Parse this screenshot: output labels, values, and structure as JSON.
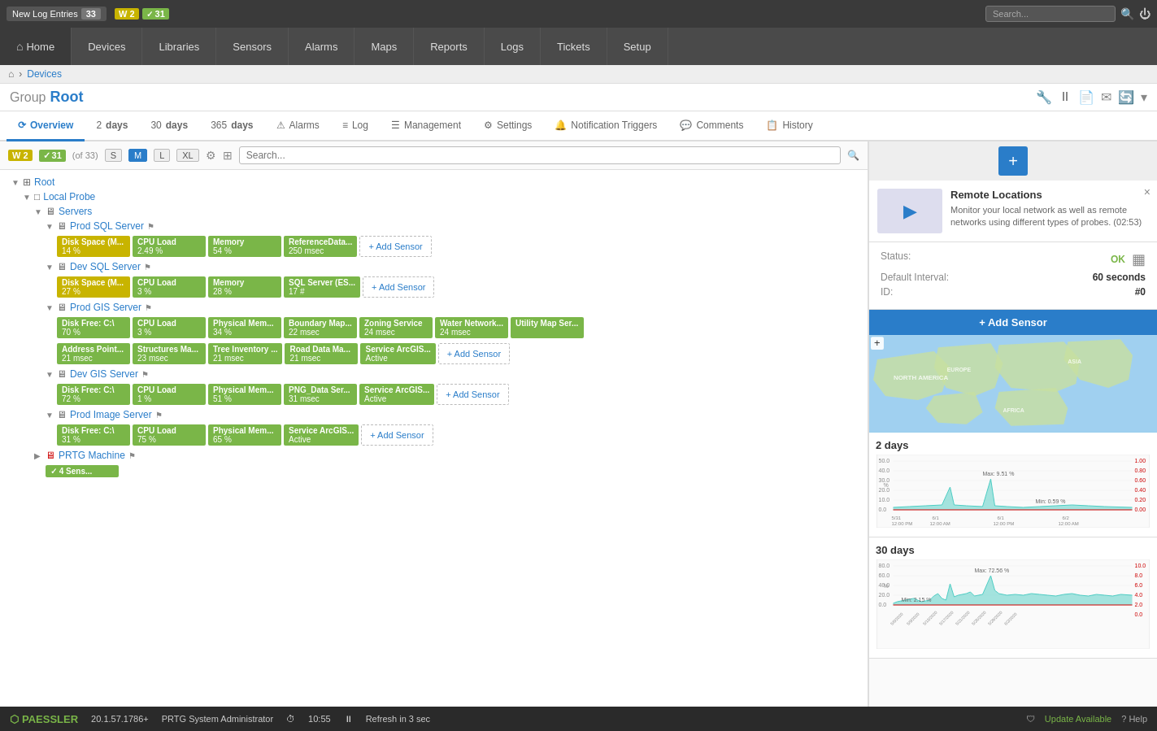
{
  "topbar": {
    "log_entries_label": "New Log Entries",
    "log_entries_count": "33",
    "warnings_label": "W",
    "warnings_count": "2",
    "ok_label": "31",
    "search_placeholder": "Search...",
    "search_label": "Search"
  },
  "mainnav": {
    "home": "Home",
    "devices": "Devices",
    "libraries": "Libraries",
    "sensors": "Sensors",
    "alarms": "Alarms",
    "maps": "Maps",
    "reports": "Reports",
    "logs": "Logs",
    "tickets": "Tickets",
    "setup": "Setup"
  },
  "breadcrumb": {
    "home": "⌂",
    "devices": "Devices"
  },
  "group": {
    "label": "Group",
    "title": "Root"
  },
  "tabs": [
    {
      "id": "overview",
      "label": "Overview",
      "icon": "⟳",
      "active": true
    },
    {
      "id": "2days",
      "label": "2  days",
      "icon": ""
    },
    {
      "id": "30days",
      "label": "30  days",
      "icon": ""
    },
    {
      "id": "365days",
      "label": "365  days",
      "icon": ""
    },
    {
      "id": "alarms",
      "label": "Alarms",
      "icon": "⚠"
    },
    {
      "id": "log",
      "label": "Log",
      "icon": "≡"
    },
    {
      "id": "management",
      "label": "Management",
      "icon": "☰"
    },
    {
      "id": "settings",
      "label": "Settings",
      "icon": "⚙"
    },
    {
      "id": "notification-triggers",
      "label": "Notification Triggers",
      "icon": "🔔"
    },
    {
      "id": "comments",
      "label": "Comments",
      "icon": "💬"
    },
    {
      "id": "history",
      "label": "History",
      "icon": "📋"
    }
  ],
  "filterbar": {
    "w_count": "2",
    "ok_count": "31",
    "of_total": "(of 33)",
    "size_s": "S",
    "size_m": "M",
    "size_l": "L",
    "size_xl": "XL",
    "search_placeholder": "Search...",
    "active_size": "M"
  },
  "tree": {
    "root_label": "Root",
    "local_probe_label": "Local Probe",
    "servers_label": "Servers",
    "nodes": [
      {
        "id": "prod-sql-server",
        "label": "Prod SQL Server",
        "has_flag": true,
        "sensors": [
          {
            "name": "Disk Space (M...",
            "value": "14 %",
            "status": "warning"
          },
          {
            "name": "CPU Load",
            "value": "2.49 %",
            "status": "ok"
          },
          {
            "name": "Memory",
            "value": "54 %",
            "status": "ok"
          },
          {
            "name": "ReferenceData...",
            "value": "250 msec",
            "status": "ok"
          },
          {
            "name": "+ Add Sensor",
            "value": "",
            "status": "add"
          }
        ]
      },
      {
        "id": "dev-sql-server",
        "label": "Dev SQL Server",
        "has_flag": true,
        "sensors": [
          {
            "name": "Disk Space (M...",
            "value": "27 %",
            "status": "warning"
          },
          {
            "name": "CPU Load",
            "value": "3 %",
            "status": "ok"
          },
          {
            "name": "Memory",
            "value": "28 %",
            "status": "ok"
          },
          {
            "name": "SQL Server (ES...",
            "value": "17 #",
            "status": "ok"
          },
          {
            "name": "+ Add Sensor",
            "value": "",
            "status": "add"
          }
        ]
      },
      {
        "id": "prod-gis-server",
        "label": "Prod GIS Server",
        "has_flag": true,
        "sensors": [
          {
            "name": "Disk Free: C:\\",
            "value": "70 %",
            "status": "ok"
          },
          {
            "name": "CPU Load",
            "value": "3 %",
            "status": "ok"
          },
          {
            "name": "Physical Mem...",
            "value": "34 %",
            "status": "ok"
          },
          {
            "name": "Boundary Map...",
            "value": "22 msec",
            "status": "ok"
          },
          {
            "name": "Zoning Service",
            "value": "24 msec",
            "status": "ok"
          },
          {
            "name": "Water Network...",
            "value": "24 msec",
            "status": "ok"
          },
          {
            "name": "Utility Map Ser...",
            "value": "",
            "status": "ok"
          },
          {
            "name": "Address Point...",
            "value": "21 msec",
            "status": "ok"
          },
          {
            "name": "Structures Ma...",
            "value": "23 msec",
            "status": "ok"
          },
          {
            "name": "Tree Inventory ...",
            "value": "21 msec",
            "status": "ok"
          },
          {
            "name": "Road Data Ma...",
            "value": "21 msec",
            "status": "ok"
          },
          {
            "name": "Service ArcGIS...",
            "value": "Active",
            "status": "ok"
          },
          {
            "name": "+ Add Sensor",
            "value": "",
            "status": "add"
          }
        ]
      },
      {
        "id": "dev-gis-server",
        "label": "Dev GIS Server",
        "has_flag": true,
        "sensors": [
          {
            "name": "Disk Free: C:\\",
            "value": "72 %",
            "status": "ok"
          },
          {
            "name": "CPU Load",
            "value": "1 %",
            "status": "ok"
          },
          {
            "name": "Physical Mem...",
            "value": "51 %",
            "status": "ok"
          },
          {
            "name": "PNG_Data Ser...",
            "value": "31 msec",
            "status": "ok"
          },
          {
            "name": "Service ArcGIS...",
            "value": "Active",
            "status": "ok"
          },
          {
            "name": "+ Add Sensor",
            "value": "",
            "status": "add"
          }
        ]
      },
      {
        "id": "prod-image-server",
        "label": "Prod Image Server",
        "has_flag": true,
        "sensors": [
          {
            "name": "Disk Free: C:\\",
            "value": "31 %",
            "status": "ok"
          },
          {
            "name": "CPU Load",
            "value": "75 %",
            "status": "ok"
          },
          {
            "name": "Physical Mem...",
            "value": "65 %",
            "status": "ok"
          },
          {
            "name": "Service ArcGIS...",
            "value": "Active",
            "status": "ok"
          },
          {
            "name": "+ Add Sensor",
            "value": "",
            "status": "add"
          }
        ]
      }
    ],
    "prtg_machine_label": "PRTG Machine",
    "prtg_machine_sensor": "✓ 4 Sens..."
  },
  "right_panel": {
    "close": "×",
    "remote_locations": {
      "title": "Remote Locations",
      "description": "Monitor your local network as well as remote networks using different types of probes. (02:53)"
    },
    "status": {
      "status_label": "Status:",
      "status_value": "OK",
      "default_interval_label": "Default Interval:",
      "default_interval_value": "60 seconds",
      "id_label": "ID:",
      "id_value": "#0"
    },
    "add_sensor_label": "+ Add Sensor",
    "map_labels": [
      "NORTH AMERICA",
      "EUROPE",
      "ASIA",
      "AFRICA"
    ],
    "chart_2days_title": "2 days",
    "chart_2days_max": "Max: 9.51 %",
    "chart_2days_min": "Min: 0.59 %",
    "chart_30days_title": "30 days",
    "chart_30days_max": "Max: 72.56 %",
    "chart_30days_min": "Min: 2.15 %",
    "chart_y_left": [
      50.0,
      40.0,
      30.0,
      20.0,
      10.0,
      0.0
    ],
    "chart_y_right": [
      1.0,
      0.8,
      0.6,
      0.4,
      0.2,
      0.0
    ]
  },
  "bottombar": {
    "logo": "PAESSLER",
    "version": "20.1.57.1786+",
    "user": "PRTG System Administrator",
    "time": "10:55",
    "refresh": "Refresh in 3 sec",
    "update": "Update Available",
    "help": "? Help"
  }
}
